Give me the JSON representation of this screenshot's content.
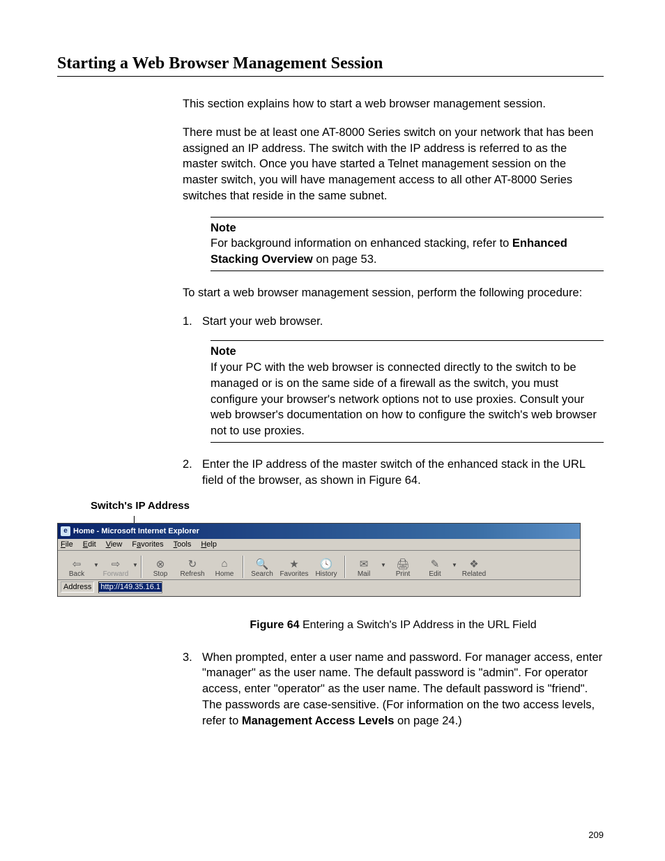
{
  "page_number": "209",
  "title": "Starting a Web Browser Management Session",
  "para1": "This section explains how to start a web browser management session.",
  "para2": "There must be at least one AT-8000 Series switch on your network that has been assigned an IP address. The switch with the IP address is referred to as the master switch. Once you have started a Telnet management session on the master switch, you will have management access to all other AT-8000 Series switches that reside in the same subnet.",
  "note1": {
    "label": "Note",
    "text_before_bold": "For background information on enhanced stacking, refer to ",
    "bold": "Enhanced Stacking Overview",
    "text_after_bold": " on page 53."
  },
  "para3": "To start a web browser management session, perform the following procedure:",
  "step1_num": "1.",
  "step1": "Start your web browser.",
  "note2": {
    "label": "Note",
    "text": "If your PC with the web browser is connected directly to the switch to be managed or is on the same side of a firewall as the switch, you must configure your browser's network options not to use proxies. Consult your web browser's documentation on how to configure the switch's web browser not to use proxies."
  },
  "step2_num": "2.",
  "step2": "Enter the IP address of the master switch of the enhanced stack in the URL field of the browser, as shown in Figure 64.",
  "fig_label": "Switch's IP Address",
  "ie": {
    "title": "Home - Microsoft Internet Explorer",
    "menu_file_u": "F",
    "menu_file": "ile",
    "menu_edit_u": "E",
    "menu_edit": "dit",
    "menu_view_u": "V",
    "menu_view": "iew",
    "menu_fav": "F",
    "menu_fav_u": "a",
    "menu_fav2": "vorites",
    "menu_tools_u": "T",
    "menu_tools": "ools",
    "menu_help_u": "H",
    "menu_help": "elp",
    "tb_back": "Back",
    "tb_forward": "Forward",
    "tb_stop": "Stop",
    "tb_refresh": "Refresh",
    "tb_home": "Home",
    "tb_search": "Search",
    "tb_favorites": "Favorites",
    "tb_history": "History",
    "tb_mail": "Mail",
    "tb_print": "Print",
    "tb_edit": "Edit",
    "tb_related": "Related",
    "addr_label_u": "d",
    "addr_label_pre": "A",
    "addr_label_post": "dress",
    "addr_value": "http://149.35.16.1"
  },
  "figure_caption_bold": "Figure 64",
  "figure_caption_rest": "  Entering a Switch's IP Address in the URL Field",
  "step3_num": "3.",
  "step3_before1": "When prompted, enter a user name and password. For manager access, enter \"manager\" as the user name. The default password is \"admin\". For operator access, enter \"operator\" as the user name. The default password is \"friend\". The passwords are case-sensitive. (For information on the two access levels, refer to ",
  "step3_bold": "Management Access Levels",
  "step3_after": " on page 24.)"
}
